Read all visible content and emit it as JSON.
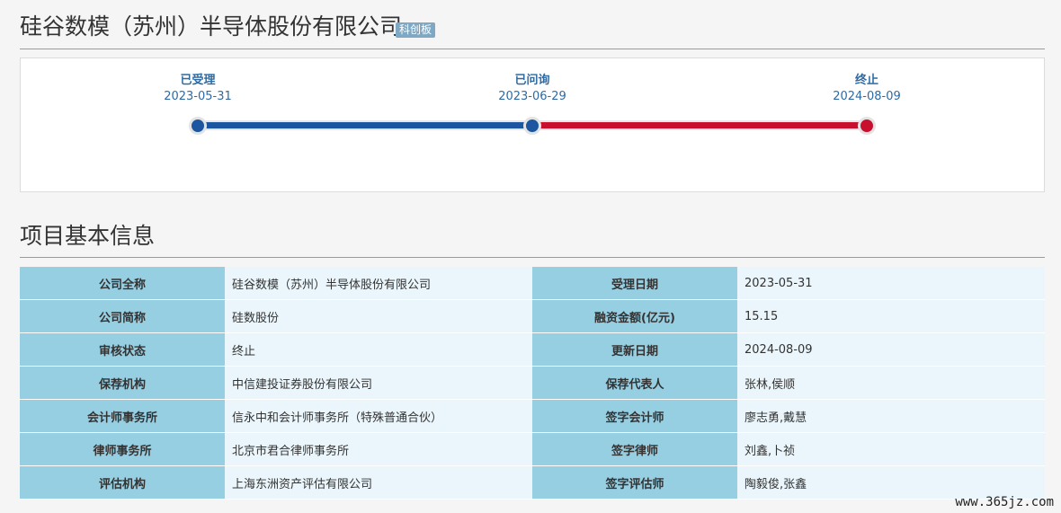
{
  "header": {
    "company_name": "硅谷数模（苏州）半导体股份有限公司",
    "board_badge": "科创板"
  },
  "timeline": {
    "steps": [
      {
        "label": "已受理",
        "date": "2023-05-31",
        "status_color": "#1c56a0"
      },
      {
        "label": "已问询",
        "date": "2023-06-29",
        "status_color": "#1c56a0"
      },
      {
        "label": "终止",
        "date": "2024-08-09",
        "status_color": "#c8102e"
      }
    ]
  },
  "section": {
    "title": "项目基本信息"
  },
  "info_table": {
    "rows": [
      {
        "left_key": "公司全称",
        "left_value": "硅谷数模（苏州）半导体股份有限公司",
        "right_key": "受理日期",
        "right_value": "2023-05-31"
      },
      {
        "left_key": "公司简称",
        "left_value": "硅数股份",
        "right_key": "融资金额(亿元)",
        "right_value": "15.15"
      },
      {
        "left_key": "审核状态",
        "left_value": "终止",
        "right_key": "更新日期",
        "right_value": "2024-08-09"
      },
      {
        "left_key": "保荐机构",
        "left_value": "中信建投证券股份有限公司",
        "right_key": "保荐代表人",
        "right_value": "张林,侯顺"
      },
      {
        "left_key": "会计师事务所",
        "left_value": "信永中和会计师事务所（特殊普通合伙）",
        "right_key": "签字会计师",
        "right_value": "廖志勇,戴慧"
      },
      {
        "left_key": "律师事务所",
        "left_value": "北京市君合律师事务所",
        "right_key": "签字律师",
        "right_value": "刘鑫,卜祯"
      },
      {
        "left_key": "评估机构",
        "left_value": "上海东洲资产评估有限公司",
        "right_key": "签字评估师",
        "right_value": "陶毅俊,张鑫"
      }
    ]
  },
  "colors": {
    "progress_done": "#1c56a0",
    "progress_terminated": "#c8102e",
    "key_cell_bg": "#97cfe2",
    "value_cell_bg": "#eaf6fb"
  },
  "watermark": "www.365jz.com"
}
